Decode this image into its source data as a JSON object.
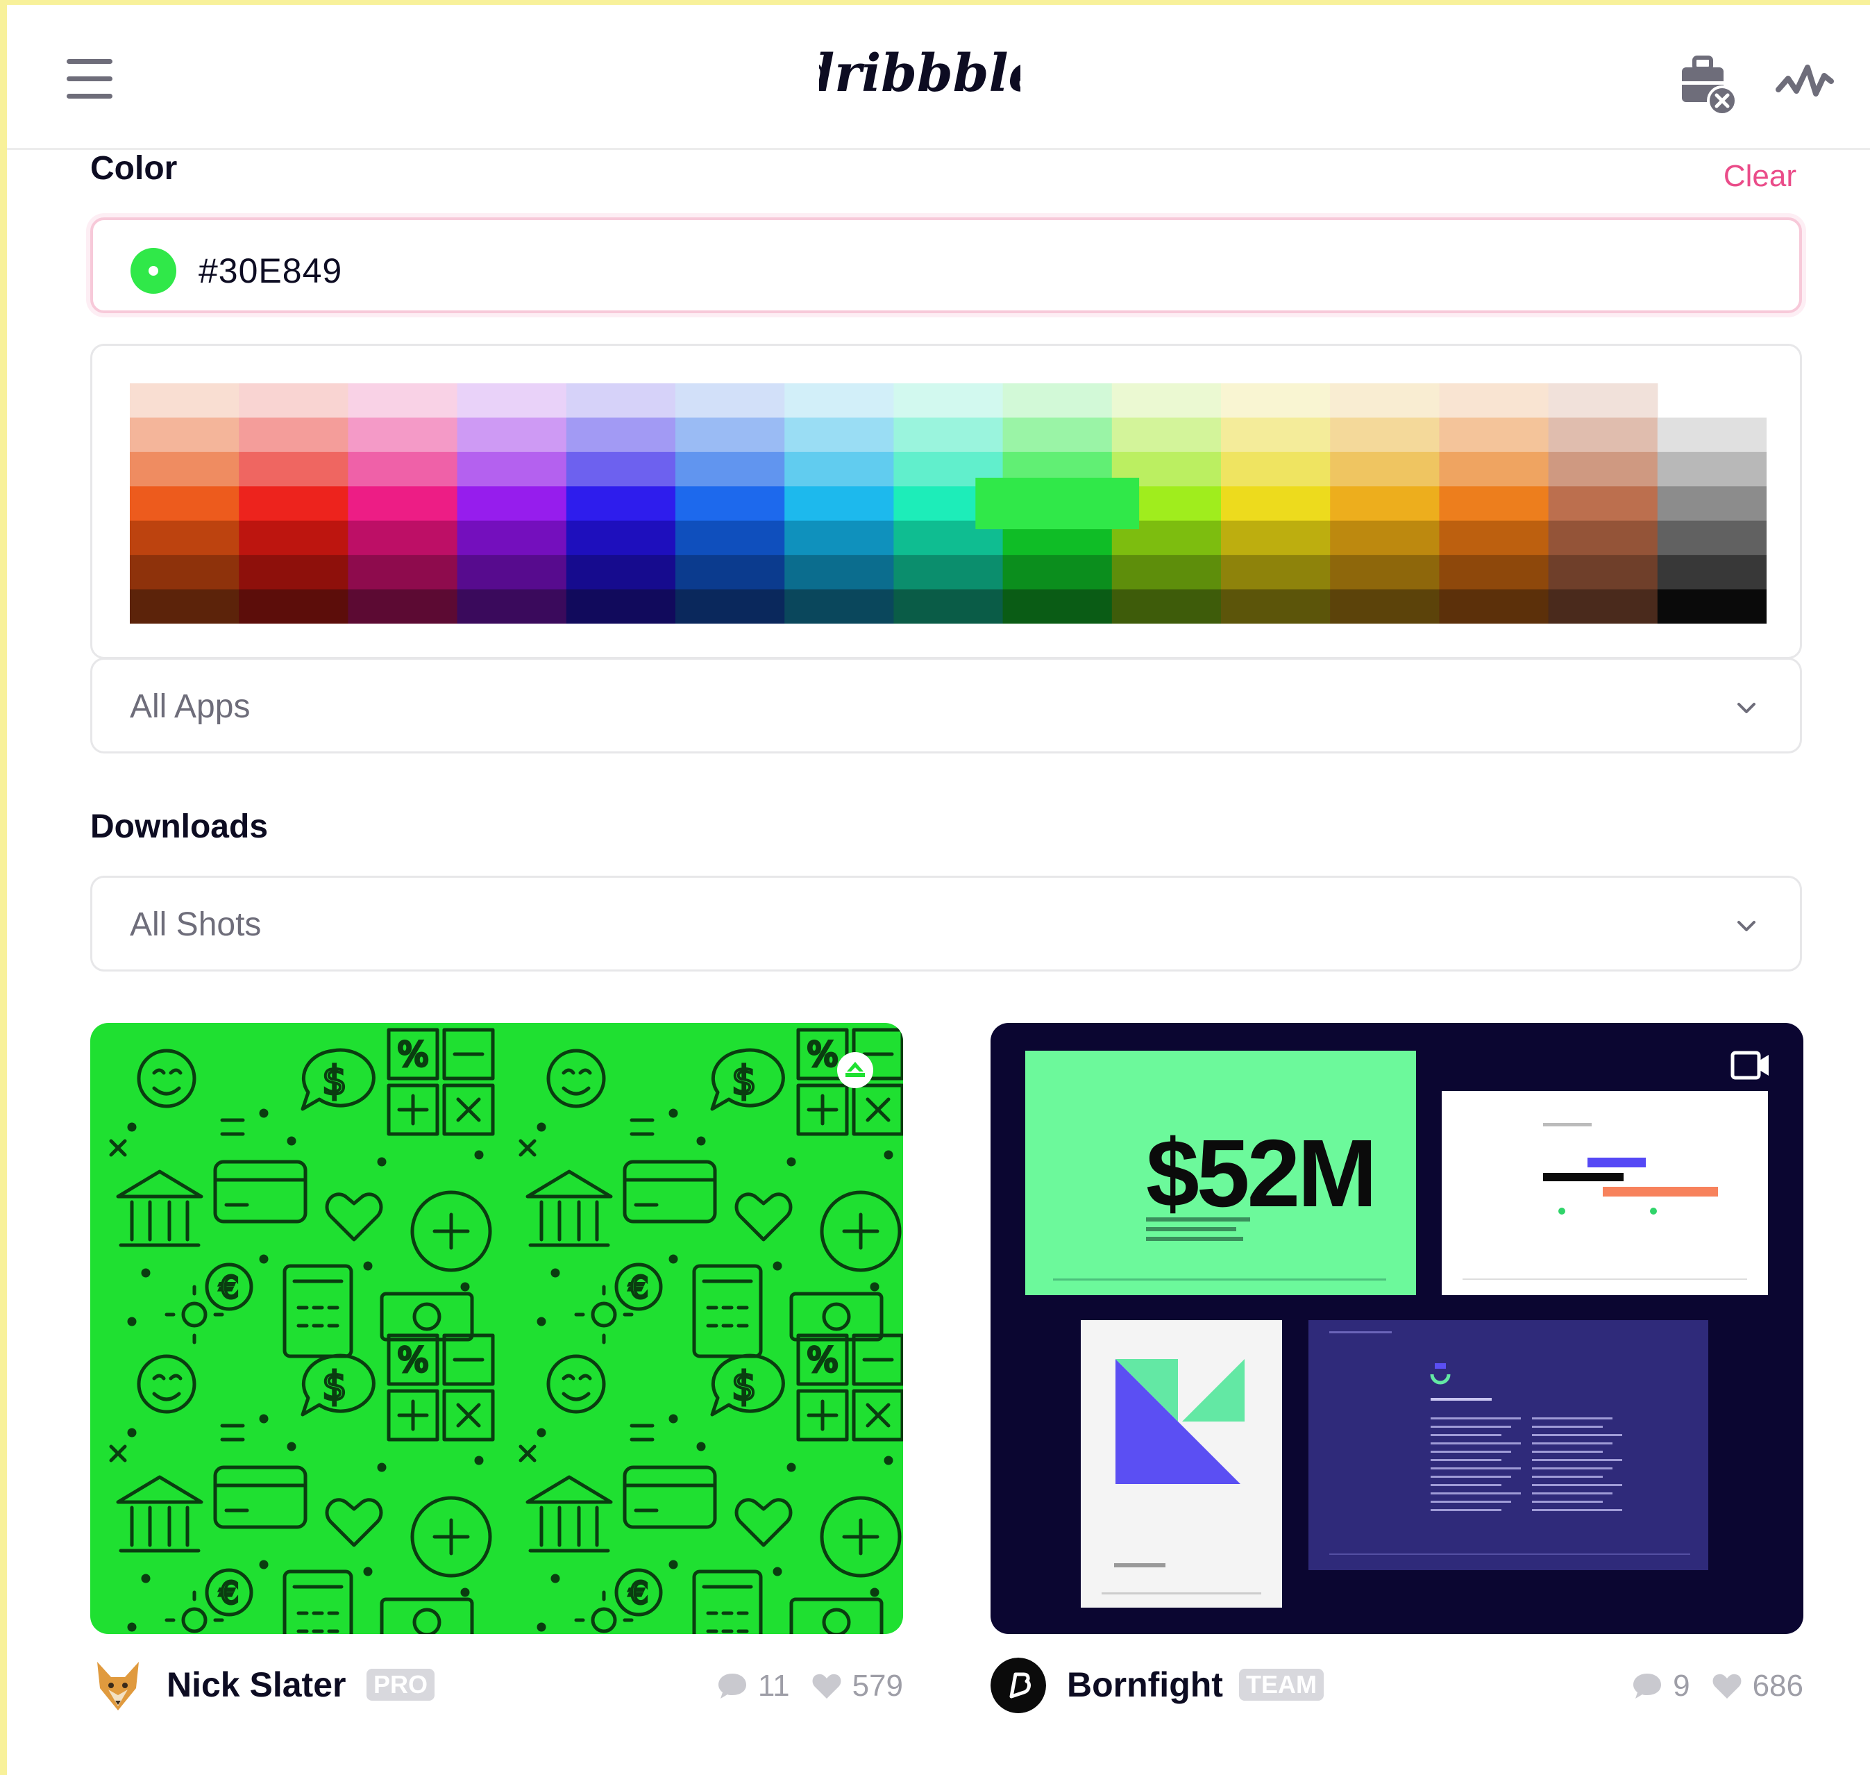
{
  "header": {
    "logo_text": "dribbble"
  },
  "filters": {
    "color_title": "Color",
    "clear_label": "Clear",
    "color_value": "#30E849",
    "selected_color": "#30e849",
    "apps_select": "All Apps",
    "downloads_title": "Downloads",
    "downloads_select": "All Shots"
  },
  "palette": {
    "selected_column": 8,
    "selected_row": 3
  },
  "shots": [
    {
      "author": "Nick Slater",
      "badge": "PRO",
      "comments": "11",
      "likes": "579",
      "background": "#1fe031"
    },
    {
      "author": "Bornfight",
      "badge": "TEAM",
      "comments": "9",
      "likes": "686",
      "background": "#0b0631",
      "headline": "$52M"
    }
  ],
  "colors": {
    "accent_pink": "#ea4c89",
    "text_dark": "#0d0c22",
    "text_muted": "#6e6d7a"
  }
}
